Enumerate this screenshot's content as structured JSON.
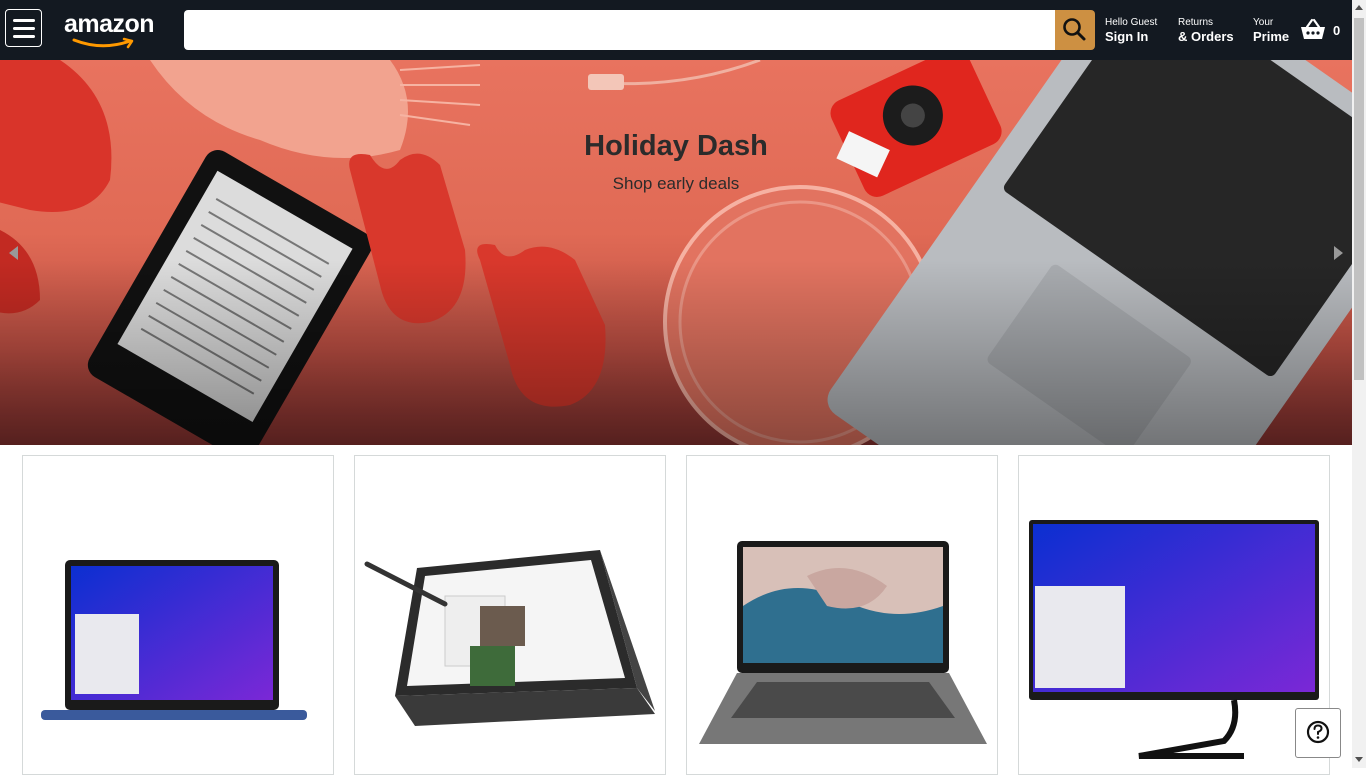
{
  "header": {
    "logo_text": "amazon",
    "search": {
      "value": "",
      "placeholder": ""
    },
    "sign_in": {
      "small": "Hello Guest",
      "big": "Sign In"
    },
    "orders": {
      "small": "Returns",
      "big": "& Orders"
    },
    "prime": {
      "small": "Your",
      "big": "Prime"
    },
    "cart_count": "0"
  },
  "hero": {
    "title": "Holiday Dash",
    "subtitle": "Shop early deals"
  },
  "products": [
    {
      "name": "laptop-blue"
    },
    {
      "name": "2in1-tent"
    },
    {
      "name": "chromebook-flip"
    },
    {
      "name": "all-in-one-desktop"
    }
  ],
  "colors": {
    "header_bg": "#131921",
    "search_button": "#cd9042",
    "hero_bg": "#e06a55"
  }
}
